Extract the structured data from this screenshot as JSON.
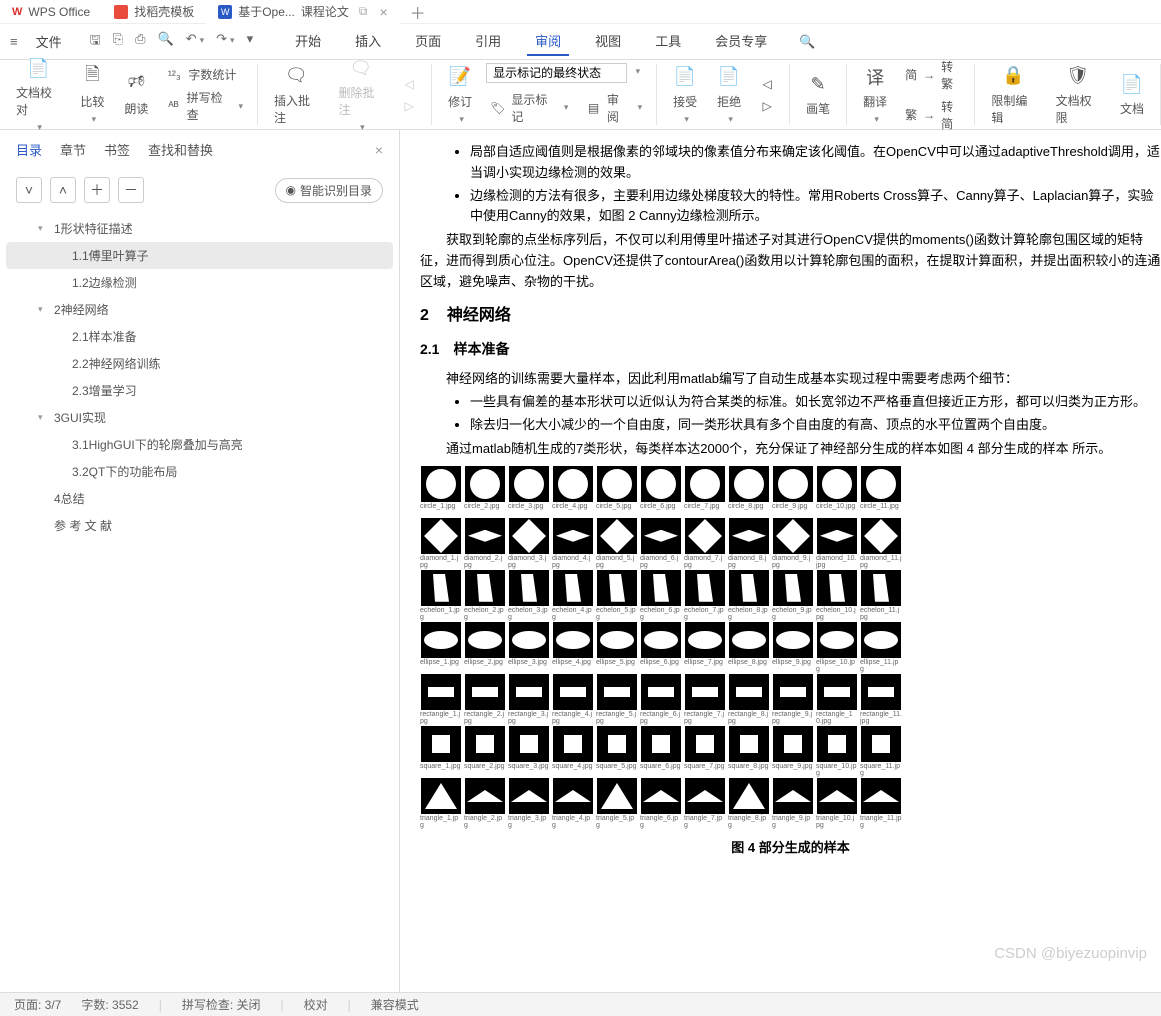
{
  "titlebar": {
    "tabs": [
      {
        "label": "WPS Office"
      },
      {
        "label": "找稻壳模板"
      },
      {
        "label": "基于Ope...",
        "suffix": "课程论文"
      }
    ]
  },
  "menubar": {
    "file": "文件",
    "tabs": [
      "开始",
      "插入",
      "页面",
      "引用",
      "审阅",
      "视图",
      "工具",
      "会员专享"
    ],
    "active": "审阅"
  },
  "ribbon": {
    "doc_proof": "文档校对",
    "compare": "比较",
    "read": "朗读",
    "word_count": "字数统计",
    "spell_check": "拼写检查",
    "insert_comment": "插入批注",
    "delete_comment": "删除批注",
    "revise": "修订",
    "select": "显示标记的最终状态",
    "show_marks": "显示标记",
    "review_pane": "审阅",
    "accept": "接受",
    "reject": "拒绝",
    "brush": "画笔",
    "translate": "翻译",
    "zh_convert1": "转繁",
    "zh_convert2": "转简",
    "zh_pre1": "简",
    "zh_pre2": "繁",
    "limit_edit": "限制编辑",
    "doc_perm": "文档权限",
    "doc_more": "文档"
  },
  "sidebar": {
    "tabs": [
      "目录",
      "章节",
      "书签",
      "查找和替换"
    ],
    "tools_smart": "智能识别目录",
    "toc": [
      {
        "lv": "h",
        "text": "1形状特征描述"
      },
      {
        "lv": "2",
        "text": "1.1傅里叶算子",
        "active": true
      },
      {
        "lv": "2",
        "text": "1.2边缘检测"
      },
      {
        "lv": "h",
        "text": "2神经网络"
      },
      {
        "lv": "2",
        "text": "2.1样本准备"
      },
      {
        "lv": "2",
        "text": "2.2神经网络训练"
      },
      {
        "lv": "2",
        "text": "2.3增量学习"
      },
      {
        "lv": "h",
        "text": "3GUI实现"
      },
      {
        "lv": "2",
        "text": "3.1HighGUI下的轮廓叠加与高亮"
      },
      {
        "lv": "2",
        "text": "3.2QT下的功能布局"
      },
      {
        "lv": "1",
        "text": "4总结"
      },
      {
        "lv": "1",
        "text": "参 考 文 献"
      }
    ]
  },
  "document": {
    "bullets_top": [
      "局部自适应阈值则是根据像素的邻域块的像素值分布来确定该化阈值。在OpenCV中可以通过adaptiveThreshold调用，适当调小实现边缘检测的效果。",
      "边缘检测的方法有很多，主要利用边缘处梯度较大的特性。常用Roberts Cross算子、Canny算子、Laplacian算子，实验中使用Canny的效果，如图 2 Canny边缘检测所示。"
    ],
    "para_top": "获取到轮廓的点坐标序列后，不仅可以利用傅里叶描述子对其进行OpenCV提供的moments()函数计算轮廓包围区域的矩特征，进而得到质心位注。OpenCV还提供了contourArea()函数用以计算轮廓包围的面积，在提取计算面积，并提出面积较小的连通区域，避免噪声、杂物的干扰。",
    "h2_num": "2",
    "h2_text": "神经网络",
    "h3_num": "2.1",
    "h3_text": "样本准备",
    "para1": "神经网络的训练需要大量样本，因此利用matlab编写了自动生成基本实现过程中需要考虑两个细节：",
    "bullets_mid": [
      "一些具有偏差的基本形状可以近似认为符合某类的标准。如长宽邻边不严格垂直但接近正方形，都可以归类为正方形。",
      "除去归一化大小减少的一个自由度，同一类形状具有多个自由度的有高、顶点的水平位置两个自由度。"
    ],
    "para2": "通过matlab随机生成的7类形状，每类样本达2000个，充分保证了神经部分生成的样本如图 4  部分生成的样本 所示。",
    "fig_caption": "图 4 部分生成的样本",
    "sample_rows": [
      {
        "shape": "circle",
        "prefix": "circle_",
        "variant": ""
      },
      {
        "shape": "diamond",
        "prefix": "diamond_",
        "variant": "flat"
      },
      {
        "shape": "echelon",
        "prefix": "echelon_",
        "variant": ""
      },
      {
        "shape": "ellipse",
        "prefix": "ellipse_",
        "variant": ""
      },
      {
        "shape": "rectangle",
        "prefix": "rectangle_",
        "variant": ""
      },
      {
        "shape": "square",
        "prefix": "square_",
        "variant": ""
      },
      {
        "shape": "triangle",
        "prefix": "triangle_",
        "variant": ""
      }
    ],
    "sample_cols": 11
  },
  "statusbar": {
    "page": "页面: 3/7",
    "words": "字数: 3552",
    "spell": "拼写检查: 关闭",
    "proof": "校对",
    "compat": "兼容模式"
  },
  "watermark": "CSDN @biyezuopinvip"
}
